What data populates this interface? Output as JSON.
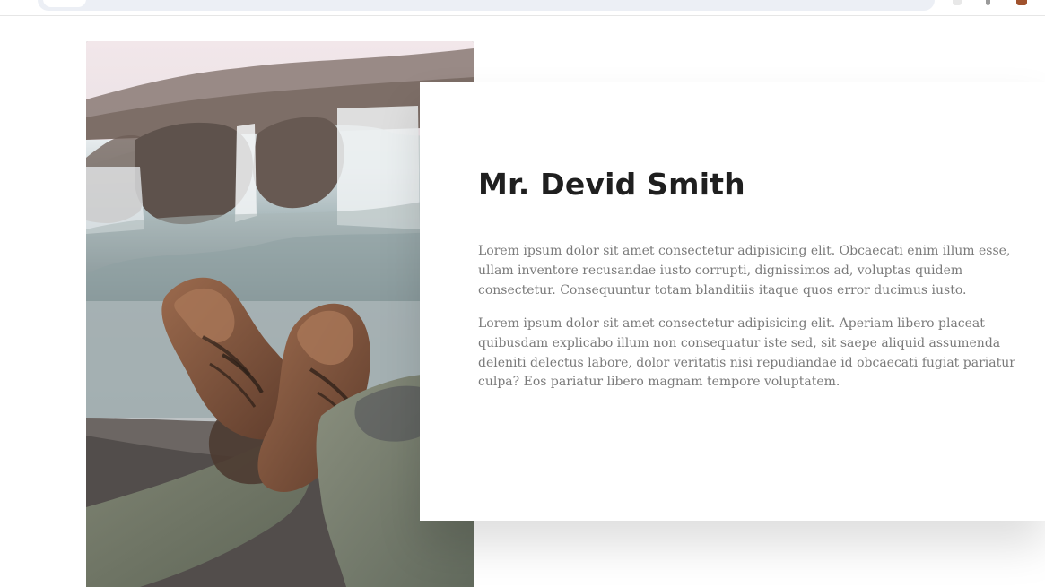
{
  "profile": {
    "name": "Mr. Devid Smith",
    "paragraphs": [
      "Lorem ipsum dolor sit amet consectetur adipisicing elit. Obcaecati enim illum esse, ullam inventore recusandae iusto corrupti, dignissimos ad, voluptas quidem consectetur. Consequuntur totam blanditiis itaque quos error ducimus iusto.",
      "Lorem ipsum dolor sit amet consectetur adipisicing elit. Aperiam libero placeat quibusdam explicabo illum non consequatur iste sed, sit saepe aliquid assumenda deleniti delectus labore, dolor veritatis nisi repudiandae id obcaecati fugiat pariatur culpa? Eos pariatur libero magnam tempore voluptatem."
    ]
  },
  "browser": {
    "star_icon": "star-icon",
    "colors": {
      "address_bar": "#eceff5",
      "divider": "#e6e6e6"
    }
  },
  "colors": {
    "page_background": "#ffffff",
    "title_text": "#1f1f1f",
    "paragraph_text": "#7a7a7a",
    "card_background": "#ffffff"
  }
}
